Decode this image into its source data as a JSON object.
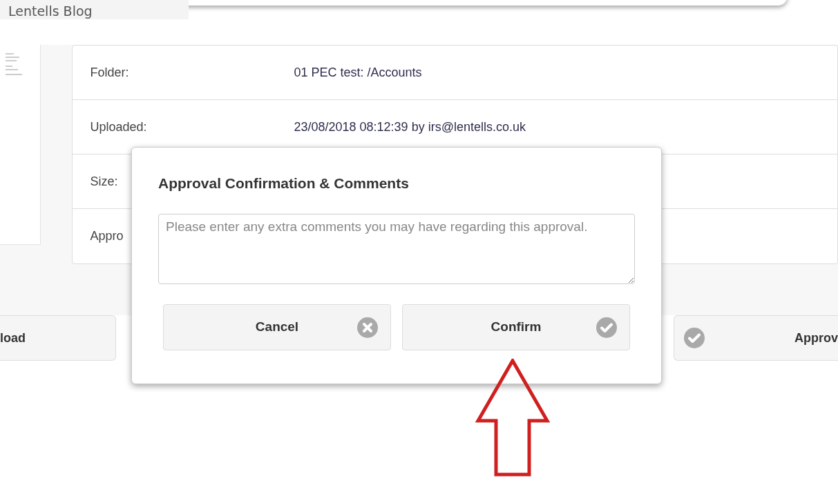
{
  "header": {
    "blog_title": "Lentells Blog"
  },
  "details": [
    {
      "label": "Folder:",
      "value": "01 PEC test: /Accounts"
    },
    {
      "label": "Uploaded:",
      "value": "23/08/2018 08:12:39 by irs@lentells.co.uk"
    },
    {
      "label": "Size:"
    },
    {
      "label": "Appro"
    }
  ],
  "action_buttons": [
    {
      "label": "load",
      "kind": "plain"
    },
    {
      "label": "Approv",
      "kind": "check"
    }
  ],
  "dialog": {
    "title": "Approval Confirmation & Comments",
    "comment": {
      "placeholder": "Please enter any extra comments you may have regarding this approval."
    },
    "buttons": [
      {
        "label": "Cancel",
        "kind": "cross"
      },
      {
        "label": "Confirm",
        "kind": "check"
      }
    ]
  }
}
